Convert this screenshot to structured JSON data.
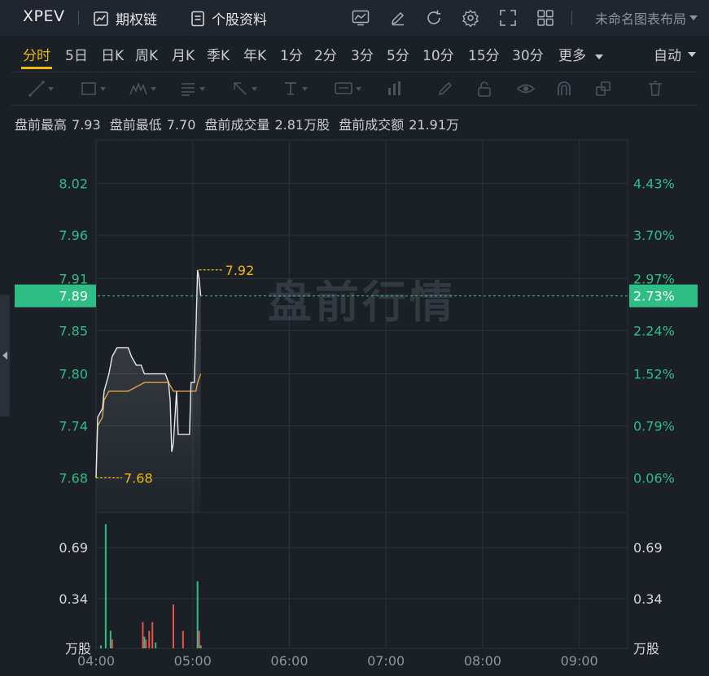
{
  "header": {
    "symbol": "XPEV",
    "options_chain": "期权链",
    "stock_info": "个股资料",
    "layout_name": "未命名图表布局"
  },
  "periods": {
    "items": [
      "分时",
      "5日",
      "日K",
      "周K",
      "月K",
      "季K",
      "年K",
      "1分",
      "2分",
      "3分",
      "5分",
      "10分",
      "15分",
      "30分"
    ],
    "active": "分时",
    "more": "更多",
    "auto": "自动"
  },
  "info": {
    "high_label": "盘前最高",
    "high": "7.93",
    "low_label": "盘前最低",
    "low": "7.70",
    "vol_label": "盘前成交量",
    "vol": "2.81万股",
    "amt_label": "盘前成交额",
    "amt": "21.91万"
  },
  "watermark": "盘前行情",
  "colors": {
    "up": "#2dbd85",
    "down": "#e6534d",
    "accent": "#f0b90b",
    "price_line": "#e4e7eb",
    "avg_line": "#e0a040",
    "axis_text": "#2dbd85",
    "current_tag_bg": "#2dbd85"
  },
  "chart_data": {
    "type": "line",
    "x_ticks": [
      "04:00",
      "05:00",
      "06:00",
      "07:00",
      "08:00",
      "09:00"
    ],
    "x_range": [
      "04:00",
      "09:30"
    ],
    "price_ticks": [
      "8.02",
      "7.96",
      "7.91",
      "7.85",
      "7.80",
      "7.74",
      "7.68"
    ],
    "pct_ticks": [
      "4.43%",
      "3.70%",
      "2.97%",
      "2.24%",
      "1.52%",
      "0.79%",
      "0.06%"
    ],
    "price_range": [
      7.64,
      8.07
    ],
    "current": {
      "price": "7.89",
      "pct": "2.73%",
      "value": 7.89
    },
    "high_mark": {
      "label": "7.92",
      "value": 7.92,
      "time": "05:04"
    },
    "low_mark": {
      "label": "7.68",
      "value": 7.68,
      "time": "04:00"
    },
    "price_series": [
      [
        "04:00",
        7.68
      ],
      [
        "04:01",
        7.75
      ],
      [
        "04:04",
        7.76
      ],
      [
        "04:05",
        7.78
      ],
      [
        "04:08",
        7.8
      ],
      [
        "04:10",
        7.82
      ],
      [
        "04:13",
        7.83
      ],
      [
        "04:15",
        7.83
      ],
      [
        "04:20",
        7.83
      ],
      [
        "04:22",
        7.82
      ],
      [
        "04:25",
        7.81
      ],
      [
        "04:28",
        7.81
      ],
      [
        "04:30",
        7.8
      ],
      [
        "04:32",
        7.8
      ],
      [
        "04:35",
        7.8
      ],
      [
        "04:38",
        7.8
      ],
      [
        "04:40",
        7.8
      ],
      [
        "04:43",
        7.8
      ],
      [
        "04:45",
        7.79
      ],
      [
        "04:46",
        7.77
      ],
      [
        "04:47",
        7.71
      ],
      [
        "04:48",
        7.72
      ],
      [
        "04:50",
        7.78
      ],
      [
        "04:51",
        7.73
      ],
      [
        "04:55",
        7.73
      ],
      [
        "04:58",
        7.73
      ],
      [
        "04:59",
        7.79
      ],
      [
        "05:00",
        7.79
      ],
      [
        "05:01",
        7.79
      ],
      [
        "05:02",
        7.85
      ],
      [
        "05:03",
        7.92
      ],
      [
        "05:04",
        7.91
      ],
      [
        "05:05",
        7.89
      ]
    ],
    "avg_series": [
      [
        "04:00",
        7.68
      ],
      [
        "04:01",
        7.74
      ],
      [
        "04:04",
        7.75
      ],
      [
        "04:05",
        7.77
      ],
      [
        "04:08",
        7.78
      ],
      [
        "04:12",
        7.78
      ],
      [
        "04:20",
        7.78
      ],
      [
        "04:30",
        7.79
      ],
      [
        "04:40",
        7.79
      ],
      [
        "04:45",
        7.79
      ],
      [
        "04:48",
        7.78
      ],
      [
        "04:55",
        7.78
      ],
      [
        "05:00",
        7.78
      ],
      [
        "05:02",
        7.78
      ],
      [
        "05:03",
        7.79
      ],
      [
        "05:05",
        7.8
      ]
    ],
    "volume": {
      "unit": "万股",
      "ticks": [
        "0.69",
        "0.34"
      ],
      "range": [
        0,
        0.93
      ],
      "bars": [
        [
          "04:03",
          0.02,
          "up"
        ],
        [
          "04:06",
          0.85,
          "up"
        ],
        [
          "04:09",
          0.12,
          "up"
        ],
        [
          "04:10",
          0.06,
          "down"
        ],
        [
          "04:29",
          0.18,
          "down"
        ],
        [
          "04:30",
          0.08,
          "up"
        ],
        [
          "04:31",
          0.06,
          "down"
        ],
        [
          "04:33",
          0.12,
          "down"
        ],
        [
          "04:35",
          0.18,
          "down"
        ],
        [
          "04:37",
          0.04,
          "up"
        ],
        [
          "04:48",
          0.3,
          "down"
        ],
        [
          "04:54",
          0.12,
          "down"
        ],
        [
          "05:03",
          0.46,
          "up"
        ],
        [
          "05:04",
          0.12,
          "down"
        ],
        [
          "05:05",
          0.02,
          "up"
        ]
      ]
    }
  }
}
